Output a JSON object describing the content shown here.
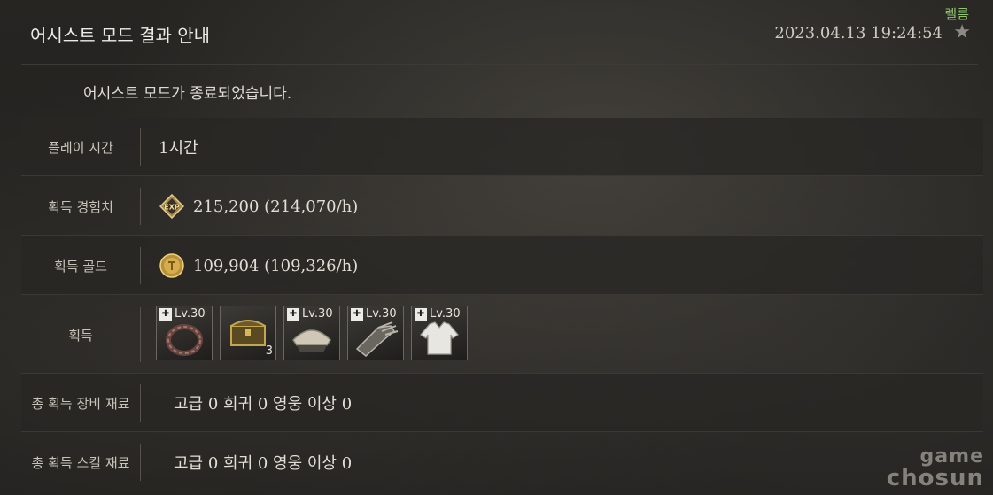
{
  "header": {
    "title": "어시스트 모드 결과 안내",
    "realm": "렐름",
    "timestamp": "2023.04.13 19:24:54",
    "favorite_icon": "star-icon"
  },
  "message": "어시스트 모드가 종료되었습니다.",
  "rows": {
    "playtime": {
      "label": "플레이 시간",
      "value": "1시간"
    },
    "exp": {
      "label": "획득 경험치",
      "value": "215,200 (214,070/h)",
      "icon": "exp-icon"
    },
    "gold": {
      "label": "획득 골드",
      "value": "109,904 (109,326/h)",
      "icon": "gold-coin-icon"
    },
    "loot": {
      "label": "획득",
      "items": [
        {
          "icon": "bracelet-icon",
          "level": "Lv.30",
          "count": ""
        },
        {
          "icon": "treasure-chest-icon",
          "level": "",
          "count": "3"
        },
        {
          "icon": "helmet-icon",
          "level": "Lv.30",
          "count": ""
        },
        {
          "icon": "gauntlet-icon",
          "level": "Lv.30",
          "count": ""
        },
        {
          "icon": "shirt-icon",
          "level": "Lv.30",
          "count": ""
        }
      ]
    },
    "equip_mats": {
      "label": "총 획득 장비 재료",
      "value": "고급 0 희귀 0 영웅 이상 0"
    },
    "skill_mats": {
      "label": "총 획득 스킬 재료",
      "value": "고급 0 희귀 0 영웅 이상 0"
    }
  },
  "watermark": {
    "line1": "game",
    "line2": "chosun"
  },
  "colors": {
    "realm": "#8fc56a",
    "accent": "#d8b65a"
  }
}
